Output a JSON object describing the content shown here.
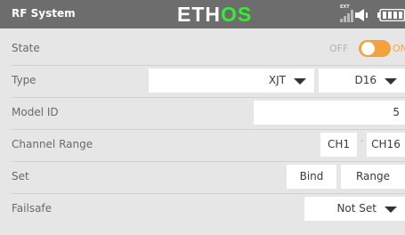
{
  "header": {
    "title": "RF System",
    "logo_text_1": "ETH",
    "logo_text_2": "OS",
    "signal_label": "EXT",
    "icons": [
      "signal-icon",
      "volume-icon",
      "battery-icon"
    ],
    "logo_accent_color": "#33ee33"
  },
  "rows": {
    "state": {
      "label": "State",
      "off_label": "OFF",
      "on_label": "ON",
      "on": true,
      "accent": "#f4a23e"
    },
    "type": {
      "label": "Type",
      "protocol": "XJT",
      "mode": "D16"
    },
    "model_id": {
      "label": "Model ID",
      "value": "5"
    },
    "channel_range": {
      "label": "Channel Range",
      "start": "CH1",
      "separator": "-",
      "end": "CH16"
    },
    "set": {
      "label": "Set",
      "bind": "Bind",
      "range": "Range"
    },
    "failsafe": {
      "label": "Failsafe",
      "value": "Not Set"
    }
  }
}
